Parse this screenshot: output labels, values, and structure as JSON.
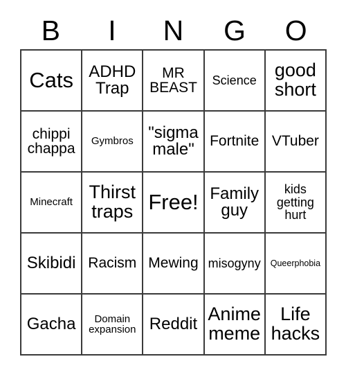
{
  "card": {
    "headers": [
      "B",
      "I",
      "N",
      "G",
      "O"
    ],
    "cells": [
      {
        "text": "Cats",
        "size": "fs-xxl"
      },
      {
        "text": "ADHD Trap",
        "size": "fs-lg"
      },
      {
        "text": "MR BEAST",
        "size": "fs-md"
      },
      {
        "text": "Science",
        "size": "fs-sm"
      },
      {
        "text": "good short",
        "size": "fs-xl"
      },
      {
        "text": "chippi chappa",
        "size": "fs-md"
      },
      {
        "text": "Gymbros",
        "size": "fs-xs"
      },
      {
        "text": "\"sigma male\"",
        "size": "fs-lg"
      },
      {
        "text": "Fortnite",
        "size": "fs-md"
      },
      {
        "text": "VTuber",
        "size": "fs-md"
      },
      {
        "text": "Minecraft",
        "size": "fs-xs"
      },
      {
        "text": "Thirst traps",
        "size": "fs-xl"
      },
      {
        "text": "Free!",
        "size": "fs-xxl"
      },
      {
        "text": "Family guy",
        "size": "fs-lg"
      },
      {
        "text": "kids getting hurt",
        "size": "fs-sm"
      },
      {
        "text": "Skibidi",
        "size": "fs-lg"
      },
      {
        "text": "Racism",
        "size": "fs-md"
      },
      {
        "text": "Mewing",
        "size": "fs-md"
      },
      {
        "text": "misogyny",
        "size": "fs-sm"
      },
      {
        "text": "Queerphobia",
        "size": "fs-xxs"
      },
      {
        "text": "Gacha",
        "size": "fs-lg"
      },
      {
        "text": "Domain expansion",
        "size": "fs-xs"
      },
      {
        "text": "Reddit",
        "size": "fs-lg"
      },
      {
        "text": "Anime meme",
        "size": "fs-xl"
      },
      {
        "text": "Life hacks",
        "size": "fs-xl"
      }
    ],
    "colors": {
      "border": "#3a3a3a",
      "cell_background": "#ffffff",
      "text": "#000000",
      "page_background": "#ffffff"
    }
  }
}
